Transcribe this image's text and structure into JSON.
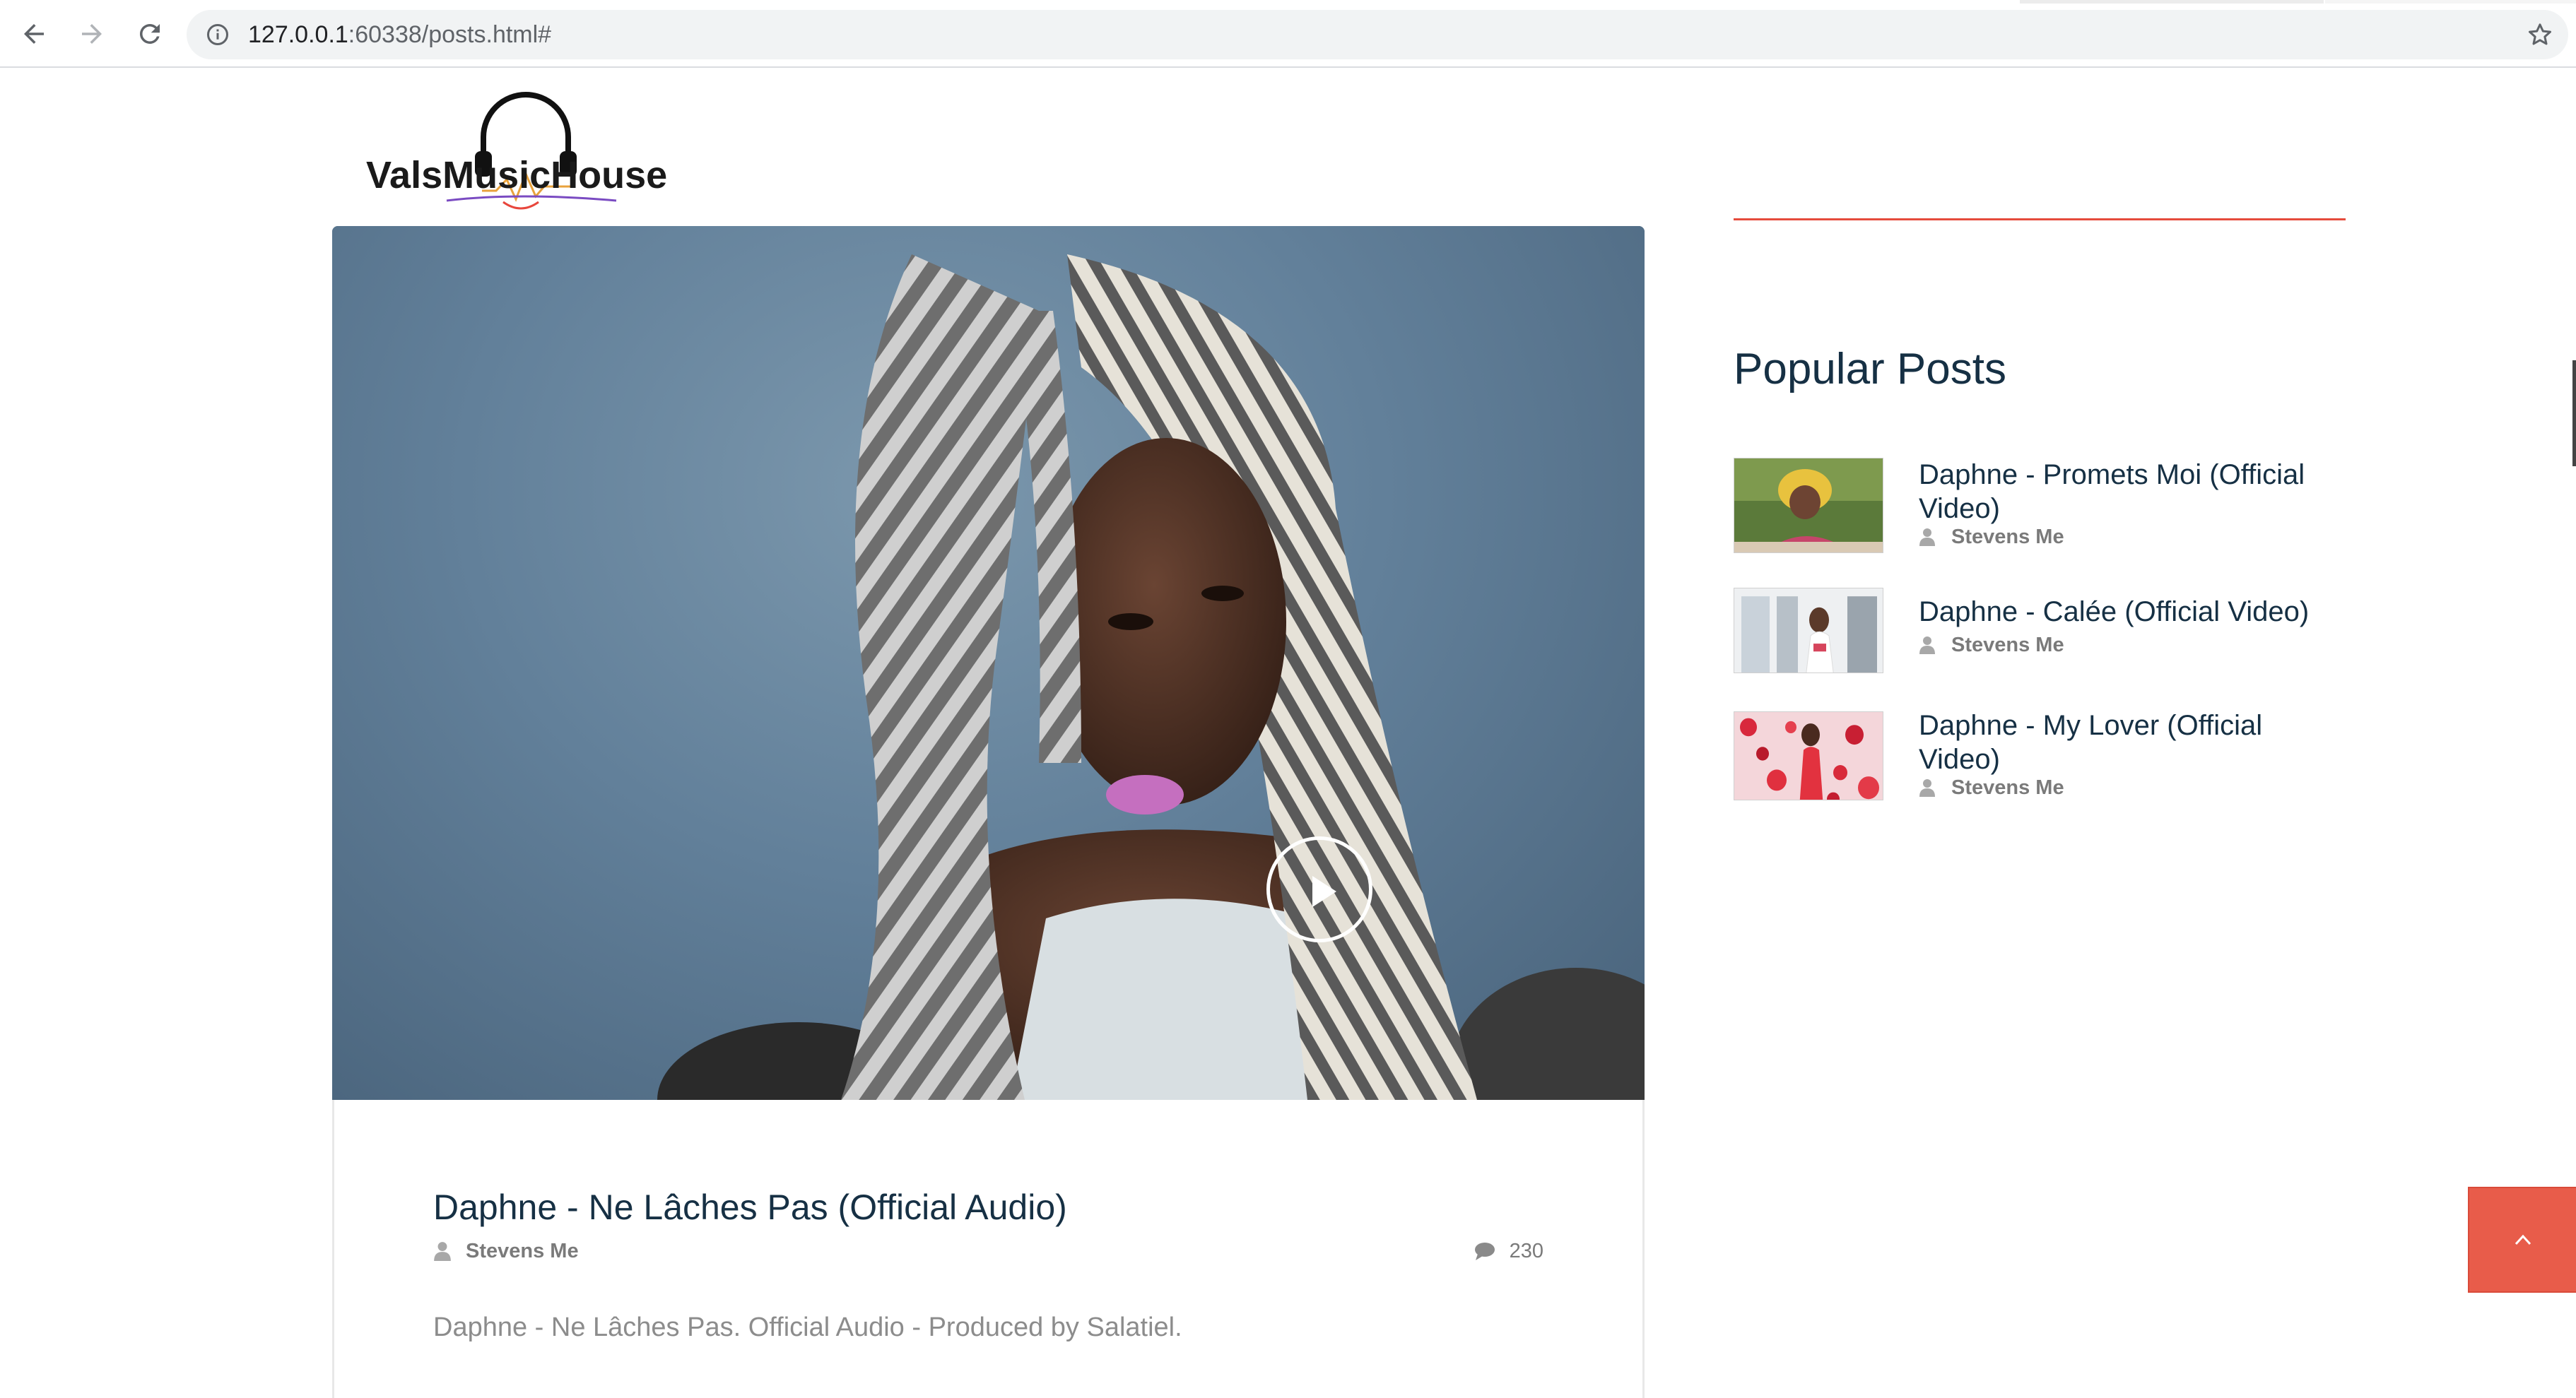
{
  "browser": {
    "url_host": "127.0.0.1",
    "url_rest": ":60338/posts.html#"
  },
  "site": {
    "logo_text": "ValsMusicHouse"
  },
  "featured": {
    "title": "Daphne - Ne Lâches Pas (Official Audio)",
    "author": "Stevens Me",
    "comments": "230",
    "description": "Daphne - Ne Lâches Pas. Official Audio - Produced by Salatiel."
  },
  "sidebar": {
    "heading": "Popular Posts",
    "posts": [
      {
        "title": "Daphne - Promets Moi (Official Video)",
        "author": "Stevens Me"
      },
      {
        "title": "Daphne - Calée (Official Video)",
        "author": "Stevens Me"
      },
      {
        "title": "Daphne - My Lover (Official Video)",
        "author": "Stevens Me"
      }
    ]
  },
  "colors": {
    "accent": "#e54b3c",
    "heading": "#163044",
    "meta": "#7a7a7a"
  },
  "icons": [
    "back-arrow-icon",
    "forward-arrow-icon",
    "reload-icon",
    "info-icon",
    "star-icon",
    "user-icon",
    "comment-icon",
    "chevron-up-icon",
    "play-icon"
  ]
}
